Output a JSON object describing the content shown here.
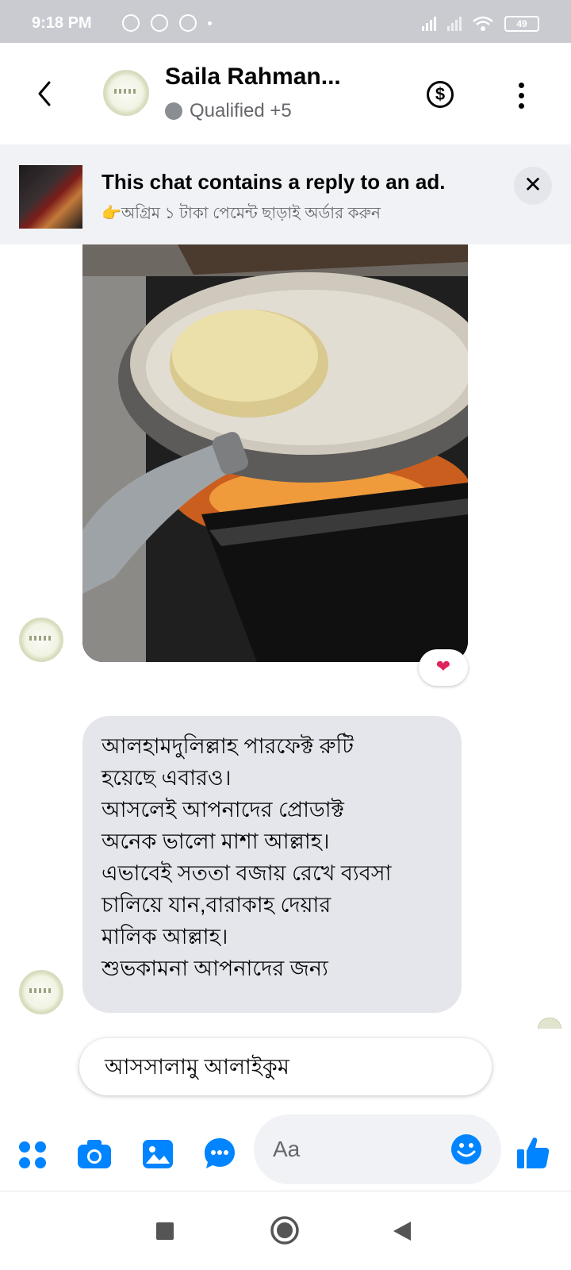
{
  "status_bar": {
    "time": "9:18 PM",
    "battery": "49"
  },
  "header": {
    "contact_name": "Saila Rahman...",
    "status": "Qualified +5",
    "dollar_symbol": "$"
  },
  "ad_banner": {
    "title": "This chat contains a reply to an ad.",
    "subtitle": "👉অগ্রিম ১ টাকা পেমেন্ট ছাড়াই অর্ডার করুন",
    "close_symbol": "✕"
  },
  "messages": {
    "reaction": "❤",
    "text_lines": [
      "আলহামদুলিল্লাহ পারফেক্ট রুটি",
      "হয়েছে এবারও।",
      "আসলেই আপনাদের প্রোডাক্ট",
      "অনেক ভালো মাশা আল্লাহ।",
      "এভাবেই সততা বজায় রেখে ব্যবসা",
      "চালিয়ে যান,বারাকাহ দেয়ার",
      "মালিক আল্লাহ।",
      "শুভকামনা আপনাদের জন্য"
    ]
  },
  "quick_reply": {
    "label": "আসসালামু আলাইকুম"
  },
  "composer": {
    "placeholder": "Aa"
  },
  "colors": {
    "accent": "#0084ff",
    "bubble": "#e4e6eb",
    "status_bar": "#c9cbd1"
  }
}
